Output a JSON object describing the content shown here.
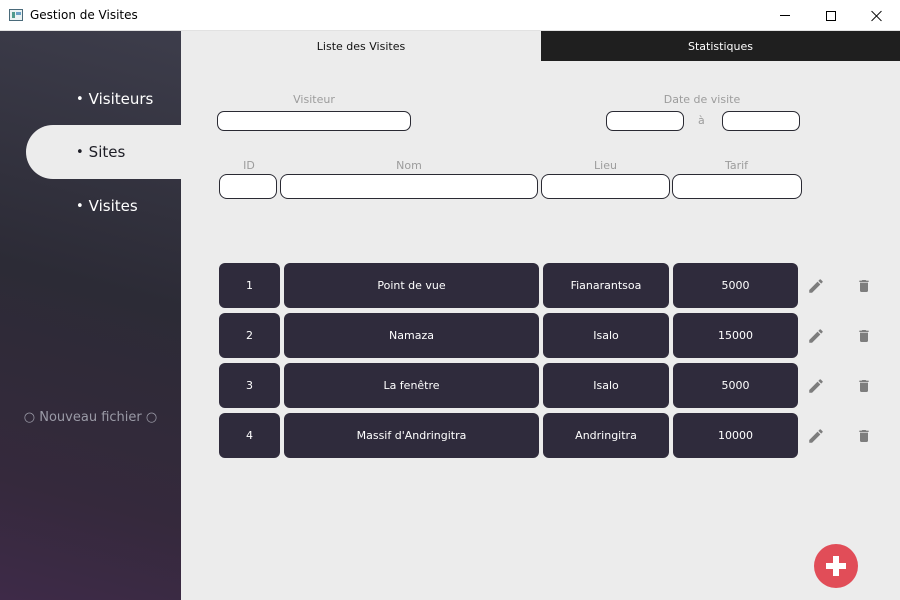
{
  "window": {
    "title": "Gestion de Visites"
  },
  "sidebar": {
    "items": [
      {
        "bullet": "•",
        "label": "Visiteurs"
      },
      {
        "bullet": "•",
        "label": "Sites"
      },
      {
        "bullet": "•",
        "label": "Visites"
      }
    ],
    "new_file": "○ Nouveau fichier ○"
  },
  "tabs": [
    {
      "label": "Liste des Visites"
    },
    {
      "label": "Statistiques"
    }
  ],
  "filters": {
    "visiteur_label": "Visiteur",
    "visiteur_value": "",
    "date_label": "Date de visite",
    "date_from": "",
    "date_sep": "à",
    "date_to": ""
  },
  "search": {
    "id_label": "ID",
    "nom_label": "Nom",
    "lieu_label": "Lieu",
    "tarif_label": "Tarif",
    "id_value": "",
    "nom_value": "",
    "lieu_value": "",
    "tarif_value": ""
  },
  "rows": [
    {
      "id": "1",
      "nom": "Point de vue",
      "lieu": "Fianarantsoa",
      "tarif": "5000"
    },
    {
      "id": "2",
      "nom": "Namaza",
      "lieu": "Isalo",
      "tarif": "15000"
    },
    {
      "id": "3",
      "nom": "La fenêtre",
      "lieu": "Isalo",
      "tarif": "5000"
    },
    {
      "id": "4",
      "nom": "Massif d'Andringitra",
      "lieu": "Andringitra",
      "tarif": "10000"
    }
  ],
  "icons": {
    "edit": "pencil-icon",
    "delete": "trash-icon",
    "add": "plus-icon"
  },
  "colors": {
    "accent": "#e14d58",
    "cell_bg": "#2f2b3c",
    "sidebar_bg": "#2c2b36",
    "tab_inactive_bg": "#1f1f1f"
  }
}
